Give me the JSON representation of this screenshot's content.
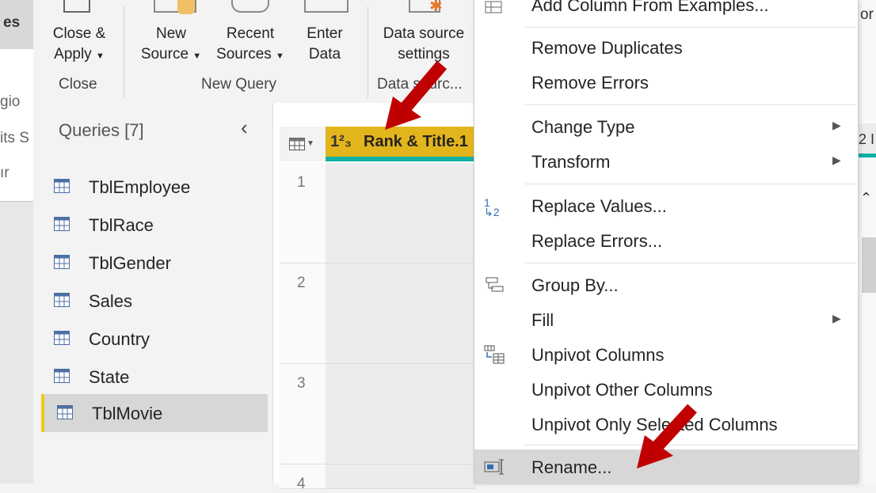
{
  "background_window": {
    "tab_label": "es",
    "lines": [
      "gio",
      "its S",
      "ır"
    ]
  },
  "ribbon": {
    "buttons": [
      {
        "label1": "Close &",
        "label2": "Apply",
        "has_dropdown": true
      },
      {
        "label1": "New",
        "label2": "Source",
        "has_dropdown": true
      },
      {
        "label1": "Recent",
        "label2": "Sources",
        "has_dropdown": true
      },
      {
        "label1": "Enter",
        "label2": "Data",
        "has_dropdown": false
      },
      {
        "label1": "Data source",
        "label2": "settings",
        "has_dropdown": false
      }
    ],
    "groups": [
      "Close",
      "New Query",
      "Data sourc..."
    ]
  },
  "queries": {
    "title": "Queries [7]",
    "items": [
      "TblEmployee",
      "TblRace",
      "TblGender",
      "Sales",
      "Country",
      "State",
      "TblMovie"
    ],
    "selected": "TblMovie"
  },
  "grid": {
    "column_type": "1²₃",
    "column_name": "Rank & Title.1",
    "rows": [
      "1",
      "2",
      "3",
      "4"
    ]
  },
  "right_strip": {
    "top_text": "or",
    "mid_text": "2 I"
  },
  "context_menu": {
    "items": [
      {
        "label": "Add Column From Examples...",
        "icon": "examples-icon",
        "submenu": false
      },
      {
        "label": "Remove Duplicates",
        "icon": "",
        "submenu": false
      },
      {
        "label": "Remove Errors",
        "icon": "",
        "submenu": false
      },
      {
        "label": "Change Type",
        "icon": "",
        "submenu": true
      },
      {
        "label": "Transform",
        "icon": "",
        "submenu": true
      },
      {
        "label": "Replace Values...",
        "icon": "replace-values-icon",
        "submenu": false
      },
      {
        "label": "Replace Errors...",
        "icon": "",
        "submenu": false
      },
      {
        "label": "Group By...",
        "icon": "group-by-icon",
        "submenu": false
      },
      {
        "label": "Fill",
        "icon": "",
        "submenu": true
      },
      {
        "label": "Unpivot Columns",
        "icon": "unpivot-icon",
        "submenu": false
      },
      {
        "label": "Unpivot Other Columns",
        "icon": "",
        "submenu": false
      },
      {
        "label": "Unpivot Only Selected Columns",
        "icon": "",
        "submenu": false
      },
      {
        "label": "Rename...",
        "icon": "rename-icon",
        "submenu": false,
        "highlighted": true
      }
    ]
  },
  "colors": {
    "column_header": "#e3b51c",
    "column_underline": "#11b0a4",
    "selected_accent": "#f2c811",
    "annotation_arrow": "#c00000"
  }
}
